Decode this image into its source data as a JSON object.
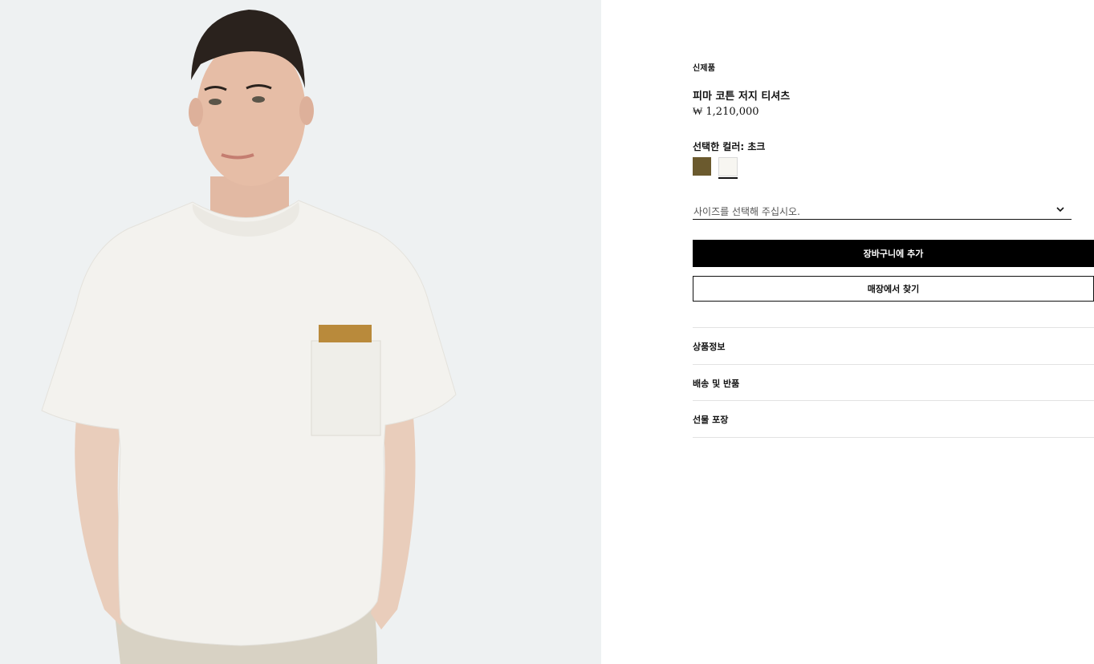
{
  "product": {
    "badge": "신제품",
    "name": "피마 코튼 저지 티셔츠",
    "price": "₩ 1,210,000"
  },
  "color": {
    "label": "선택한 컬러: 초크",
    "swatches": [
      {
        "name": "brown",
        "hex": "#6b5a2e"
      },
      {
        "name": "chalk",
        "hex": "#f7f6f1",
        "selected": true
      }
    ]
  },
  "size": {
    "placeholder": "사이즈를 선택해 주십시오."
  },
  "actions": {
    "add_to_cart": "장바구니에 추가",
    "find_in_store": "매장에서 찾기"
  },
  "accordion": [
    {
      "label": "상품정보"
    },
    {
      "label": "배송 및 반품"
    },
    {
      "label": "선물 포장"
    }
  ]
}
